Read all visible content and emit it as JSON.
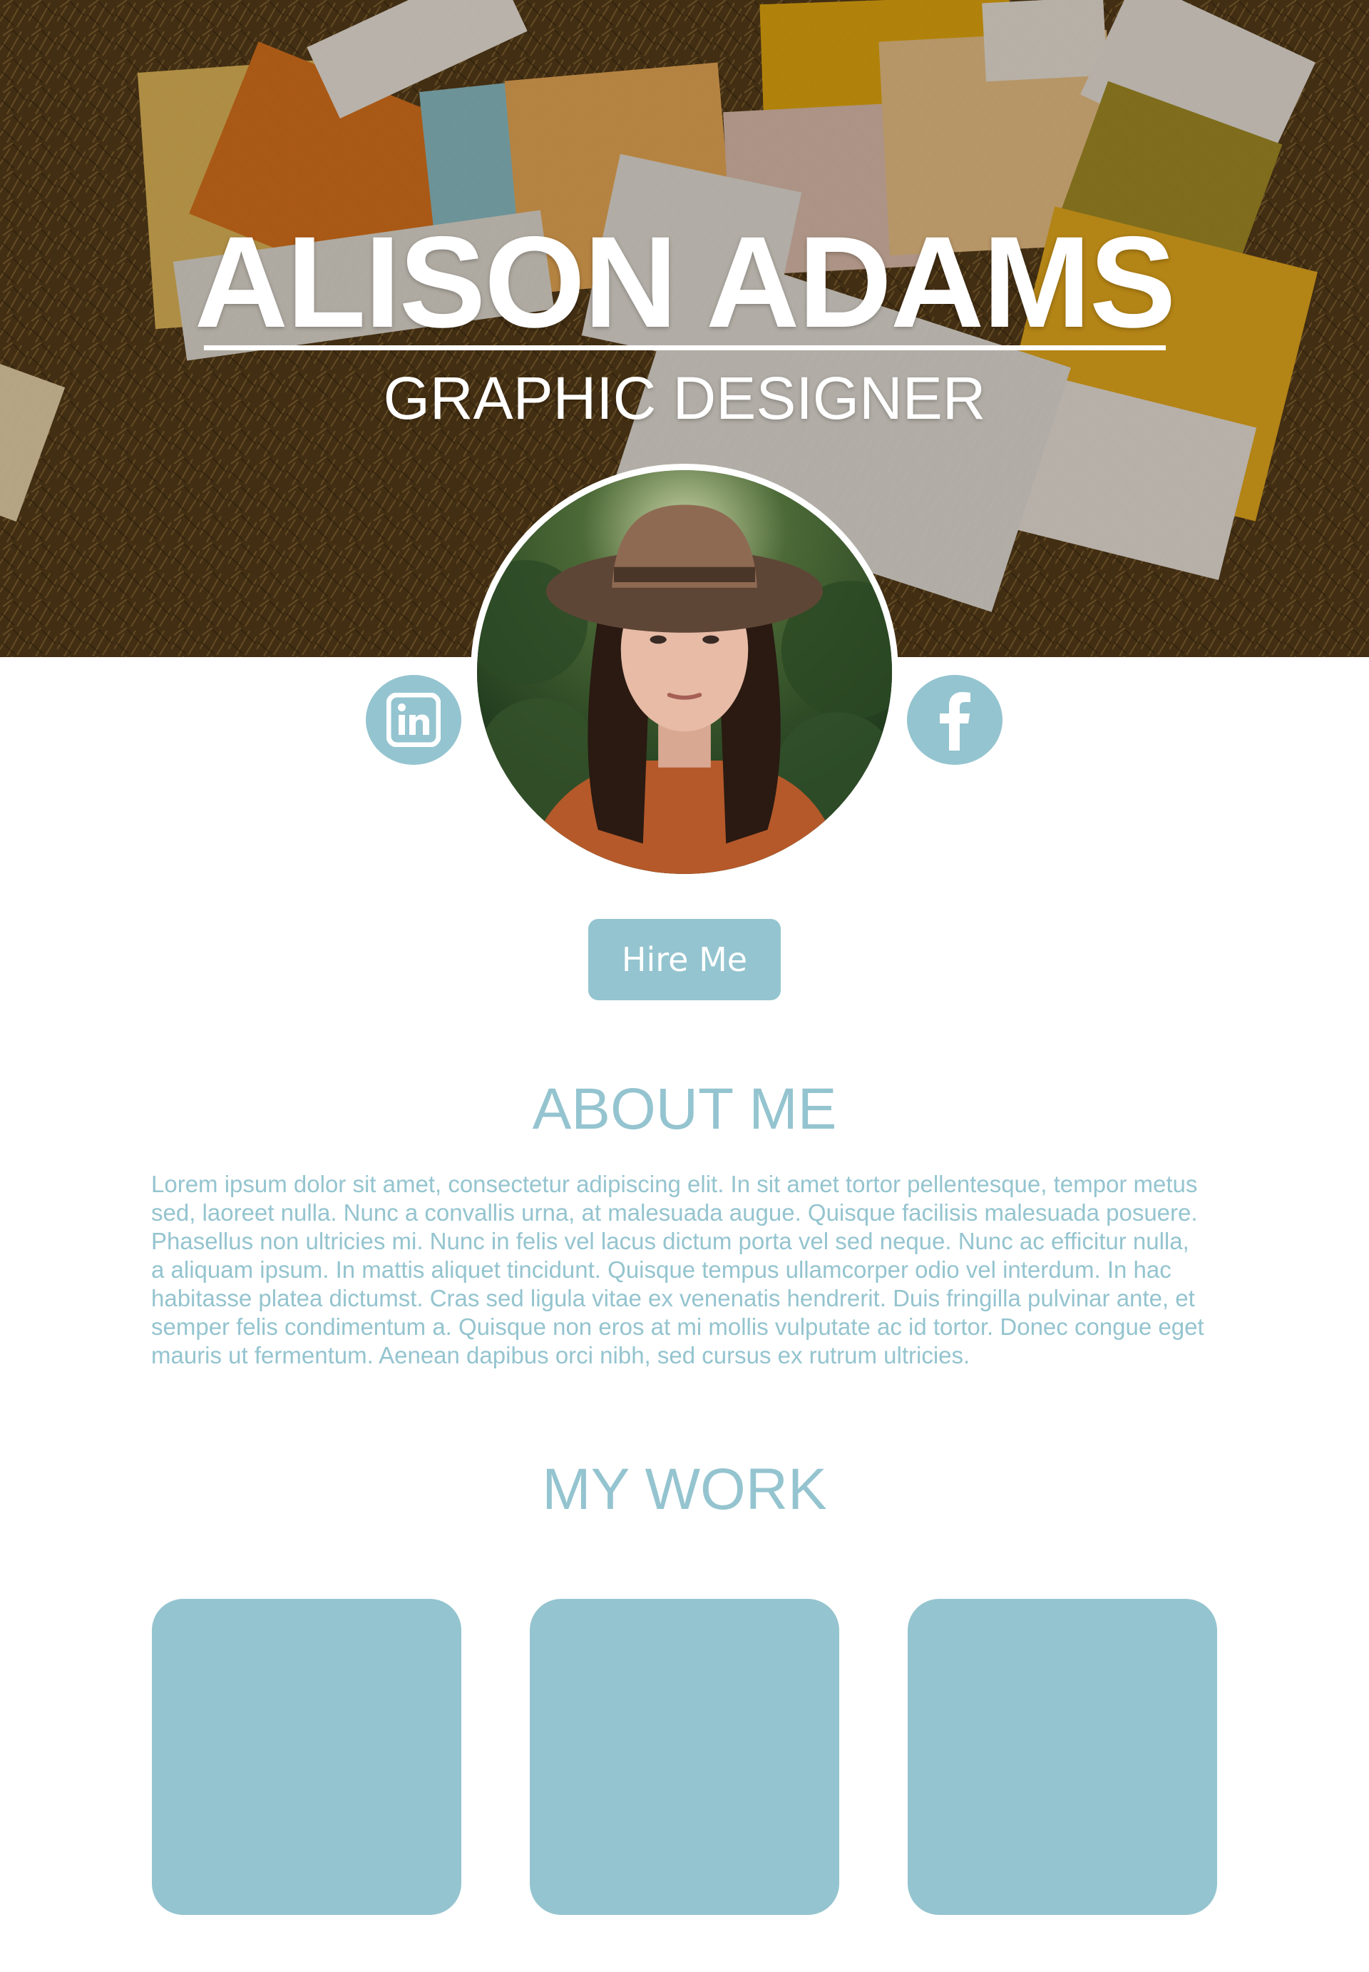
{
  "hero": {
    "name": "ALISON ADAMS",
    "role": "GRAPHIC DESIGNER"
  },
  "social": {
    "linkedin_icon": "linkedin-icon",
    "facebook_icon": "facebook-icon"
  },
  "hire_button": {
    "label": "Hire Me"
  },
  "about": {
    "title": "ABOUT ME",
    "body": "Lorem ipsum dolor sit amet, consectetur adipiscing elit. In sit amet tortor pellentesque, tempor metus sed, laoreet nulla. Nunc a convallis urna, at malesuada augue. Quisque facilisis malesuada posuere. Phasellus non ultricies mi. Nunc in felis vel lacus dictum porta vel sed neque. Nunc ac efficitur nulla, a aliquam ipsum. In mattis aliquet tincidunt. Quisque tempus ullamcorper odio vel interdum. In hac habitasse platea dictumst. Cras sed ligula vitae ex venenatis hendrerit. Duis fringilla pulvinar ante, et semper felis condimentum a. Quisque non eros at mi mollis vulputate ac id tortor. Donec congue eget mauris ut fermentum. Aenean dapibus orci nibh, sed cursus ex rutrum ultricies."
  },
  "work": {
    "title": "MY WORK"
  },
  "colors": {
    "accent": "#94c4cf",
    "text_on_accent": "#ffffff"
  }
}
